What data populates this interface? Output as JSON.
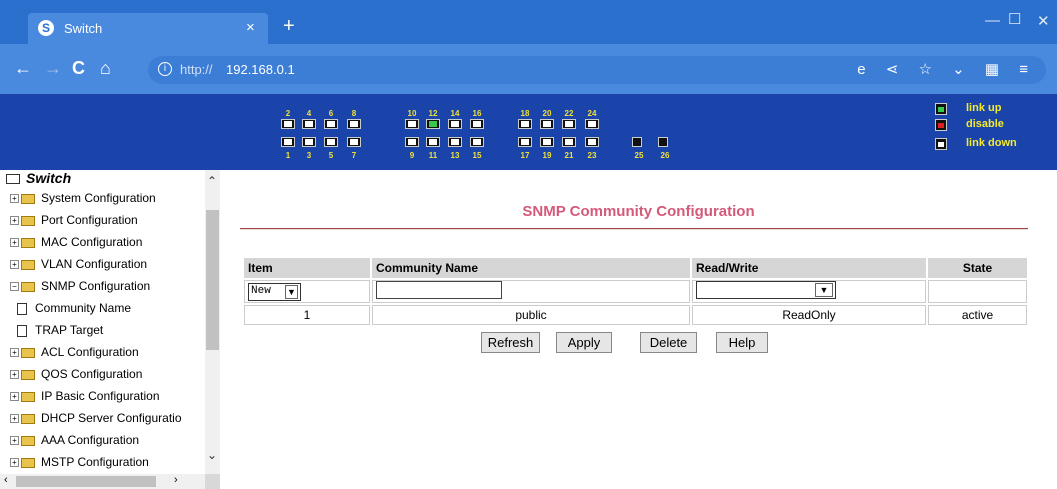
{
  "browser": {
    "tab_title": "Switch",
    "tab_close": "×",
    "new_tab": "+",
    "url_scheme": "http://",
    "url_host": "192.168.0.1"
  },
  "banner": {
    "top_numbers": [
      "2",
      "4",
      "6",
      "8",
      "10",
      "12",
      "14",
      "16",
      "18",
      "20",
      "22",
      "24"
    ],
    "bottom_numbers": [
      "1",
      "3",
      "5",
      "7",
      "9",
      "11",
      "13",
      "15",
      "17",
      "19",
      "21",
      "23",
      "25",
      "26"
    ],
    "legend": {
      "up": "link up",
      "disable": "disable",
      "down": "link down"
    },
    "colors": {
      "background": "#1a44a9",
      "link_up": "#39c84c",
      "disable": "#e02020",
      "text": "#f6ea2c"
    }
  },
  "sidebar": {
    "root": "Switch",
    "items": [
      {
        "label": "System Configuration"
      },
      {
        "label": "Port Configuration"
      },
      {
        "label": "MAC Configuration"
      },
      {
        "label": "VLAN Configuration"
      },
      {
        "label": "SNMP Configuration"
      },
      {
        "label": "Community Name"
      },
      {
        "label": "TRAP Target"
      },
      {
        "label": "ACL Configuration"
      },
      {
        "label": "QOS Configuration"
      },
      {
        "label": "IP Basic Configuration"
      },
      {
        "label": "DHCP Server Configuratio"
      },
      {
        "label": "AAA Configuration"
      },
      {
        "label": "MSTP Configuration"
      }
    ]
  },
  "main": {
    "title": "SNMP Community Configuration",
    "headers": {
      "item": "Item",
      "name": "Community Name",
      "rw": "Read/Write",
      "state": "State"
    },
    "new_row": {
      "item_select": "New",
      "name_value": "",
      "rw_select": ""
    },
    "rows": [
      {
        "item": "1",
        "name": "public",
        "rw": "ReadOnly",
        "state": "active"
      }
    ],
    "buttons": {
      "refresh": "Refresh",
      "apply": "Apply",
      "delete": "Delete",
      "help": "Help"
    }
  }
}
